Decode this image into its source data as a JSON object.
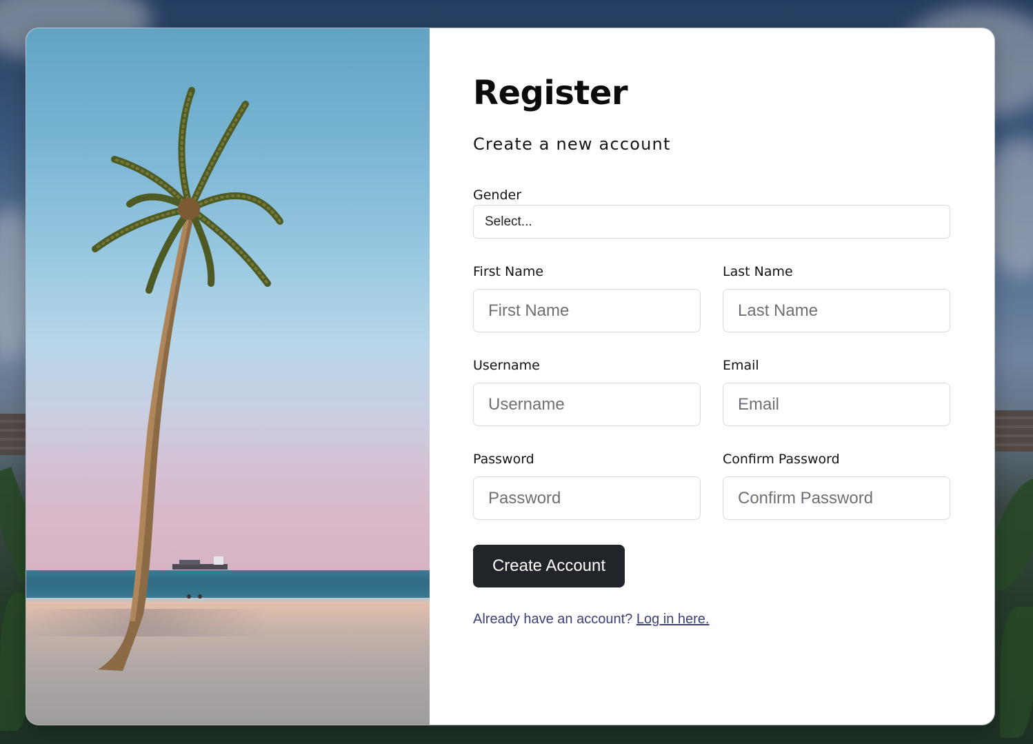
{
  "form": {
    "title": "Register",
    "subtitle": "Create a new account",
    "gender": {
      "label": "Gender",
      "selected": "Select..."
    },
    "first_name": {
      "label": "First Name",
      "placeholder": "First Name"
    },
    "last_name": {
      "label": "Last Name",
      "placeholder": "Last Name"
    },
    "username": {
      "label": "Username",
      "placeholder": "Username"
    },
    "email": {
      "label": "Email",
      "placeholder": "Email"
    },
    "password": {
      "label": "Password",
      "placeholder": "Password"
    },
    "confirm_password": {
      "label": "Confirm Password",
      "placeholder": "Confirm Password"
    },
    "submit_label": "Create Account",
    "login_prompt": "Already have an account?",
    "login_link": "Log in here."
  },
  "colors": {
    "button_bg": "#212529",
    "link": "#3a3f7a",
    "input_border": "#d6d9de"
  },
  "illustration": {
    "photo": "palm-tree-beach-photo",
    "background": "resort-background-photo"
  }
}
